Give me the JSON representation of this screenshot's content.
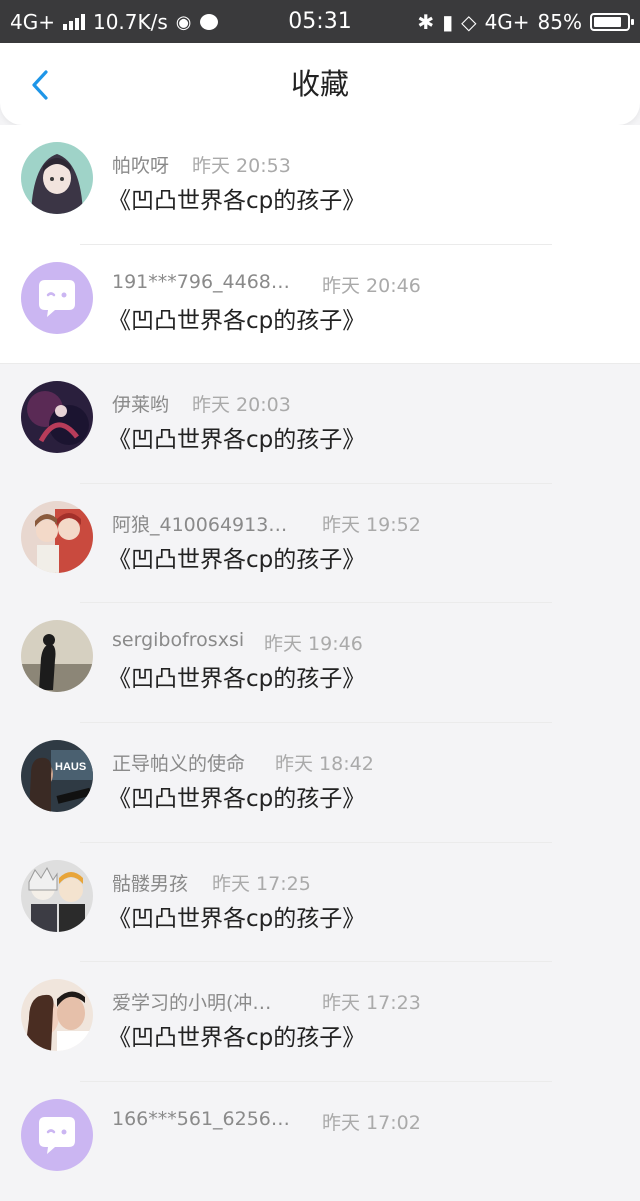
{
  "status_bar": {
    "network": "4G+",
    "speed": "10.7K/s",
    "time": "05:31",
    "network_right": "4G+",
    "battery": "85%",
    "battery_level": 0.85
  },
  "nav": {
    "title": "收藏"
  },
  "items": [
    {
      "name": "帕吹呀",
      "time": "昨天 20:53",
      "subject": "《凹凸世界各cp的孩子》"
    },
    {
      "name": "191***796_4468…",
      "time": "昨天 20:46",
      "subject": "《凹凸世界各cp的孩子》"
    },
    {
      "name": "伊莱哟",
      "time": "昨天 20:03",
      "subject": "《凹凸世界各cp的孩子》"
    },
    {
      "name": "阿狼_410064913…",
      "time": "昨天 19:52",
      "subject": "《凹凸世界各cp的孩子》"
    },
    {
      "name": "sergibofrosxsi",
      "time": "昨天 19:46",
      "subject": "《凹凸世界各cp的孩子》"
    },
    {
      "name": "正导帕义的使命",
      "time": "昨天 18:42",
      "subject": "《凹凸世界各cp的孩子》"
    },
    {
      "name": "骷髅男孩",
      "time": "昨天 17:25",
      "subject": "《凹凸世界各cp的孩子》"
    },
    {
      "name": "爱学习的小明(冲…",
      "time": "昨天 17:23",
      "subject": "《凹凸世界各cp的孩子》"
    },
    {
      "name": "166***561_6256…",
      "time": "昨天 17:02",
      "subject": ""
    }
  ],
  "avatar_text": "HAUS",
  "colors": {
    "accent": "#1e96e8",
    "default_avatar": "#cbb6f2"
  }
}
